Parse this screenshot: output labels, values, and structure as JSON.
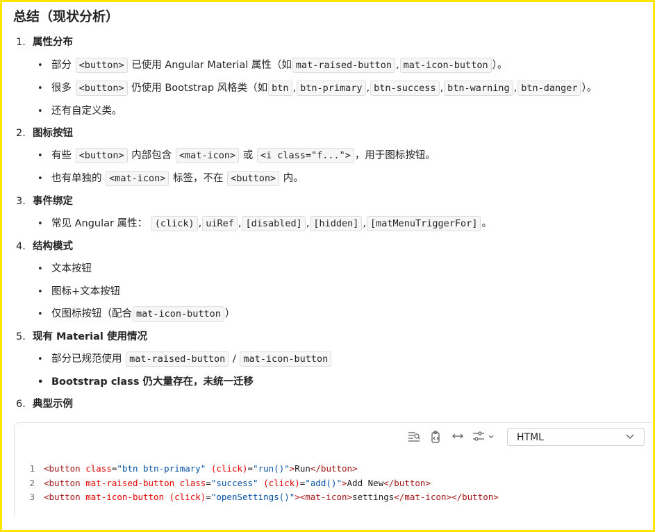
{
  "title": "总结（现状分析）",
  "sections": [
    {
      "num": "1.",
      "heading": "属性分布",
      "items": [
        {
          "t1": "部分",
          "c1": "<button>",
          "t2": "已使用 Angular Material 属性（如",
          "c2": "mat-raised-button",
          "t3": ",",
          "c3": "mat-icon-button",
          "t4": "）。"
        },
        {
          "t1": "很多",
          "c1": "<button>",
          "t2": "仍使用 Bootstrap 风格类（如",
          "c2": "btn",
          "t3": ",",
          "c3": "btn-primary",
          "t4": ",",
          "c4": "btn-success",
          "t5": ",",
          "c5": "btn-warning",
          "t6": ",",
          "c6": "btn-danger",
          "t7": "）。"
        },
        {
          "t1": "还有自定义类。"
        }
      ]
    },
    {
      "num": "2.",
      "heading": "图标按钮",
      "items": [
        {
          "t1": "有些",
          "c1": "<button>",
          "t2": "内部包含",
          "c2": "<mat-icon>",
          "t3": "或",
          "c3": "<i class=\"f...\">",
          "t4": "，用于图标按钮。"
        },
        {
          "t1": "也有单独的",
          "c1": "<mat-icon>",
          "t2": "标签，不在",
          "c2": "<button>",
          "t3": "内。"
        }
      ]
    },
    {
      "num": "3.",
      "heading": "事件绑定",
      "items": [
        {
          "t1": "常见 Angular 属性：",
          "c1": "(click)",
          "t2": ",",
          "c2": "uiRef",
          "t3": ",",
          "c3": "[disabled]",
          "t4": ",",
          "c4": "[hidden]",
          "t5": ",",
          "c5": "[matMenuTriggerFor]",
          "t6": "。"
        }
      ]
    },
    {
      "num": "4.",
      "heading": "结构模式",
      "items": [
        {
          "t1": "文本按钮"
        },
        {
          "t1": "图标+文本按钮"
        },
        {
          "t1": "仅图标按钮（配合",
          "c1": "mat-icon-button",
          "t2": "）"
        }
      ]
    },
    {
      "num": "5.",
      "heading": "现有 Material 使用情况",
      "items": [
        {
          "t1": "部分已规范使用",
          "c1": "mat-raised-button",
          "t2": "/",
          "c2": "mat-icon-button"
        },
        {
          "t1": "Bootstrap class 仍大量存在，未统一迁移"
        }
      ]
    },
    {
      "num": "6.",
      "heading": "典型示例"
    }
  ],
  "bullet": "•",
  "codeblock": {
    "language": "HTML",
    "toolbar_icons": [
      "wrap-lines-icon",
      "copy-code-icon",
      "expand-width-icon",
      "settings-sliders-icon"
    ],
    "lines": [
      {
        "n": "1",
        "a": "<button ",
        "b": "class",
        "c": "=",
        "d": "\"btn btn-primary\"",
        "e": " (click)",
        "f": "=",
        "g": "\"run()\"",
        "h": ">",
        "i": "Run",
        "j": "</button>"
      },
      {
        "n": "2",
        "a": "<button ",
        "b": "mat-raised-button class",
        "c": "=",
        "d": "\"success\"",
        "e": " (click)",
        "f": "=",
        "g": "\"add()\"",
        "h": ">",
        "i": "Add New",
        "j": "</button>"
      },
      {
        "n": "3",
        "a": "<button ",
        "b": "mat-icon-button (click)",
        "c": "=",
        "d": "\"openSettings()\"",
        "e": "><mat-icon>",
        "f": "",
        "g": "",
        "h": "",
        "i": "settings",
        "j": "</mat-icon></button>"
      }
    ]
  },
  "colors": {
    "frame": "#ffe600"
  }
}
